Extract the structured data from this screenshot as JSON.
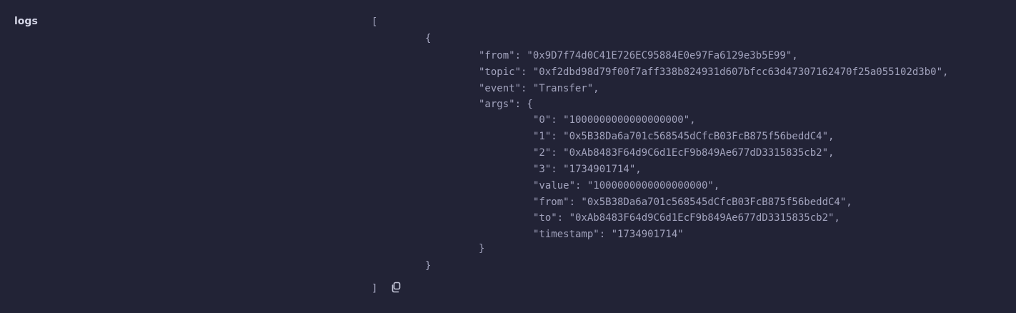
{
  "field": {
    "label": "logs"
  },
  "json_lines": {
    "open_bracket": "[",
    "open_brace": "{",
    "from": "\"from\": \"0x9D7f74d0C41E726EC95884E0e97Fa6129e3b5E99\",",
    "topic": "\"topic\": \"0xf2dbd98d79f00f7aff338b824931d607bfcc63d47307162470f25a055102d3b0\",",
    "event": "\"event\": \"Transfer\",",
    "args_open": "\"args\": {",
    "arg_0": "\"0\": \"1000000000000000000\",",
    "arg_1": "\"1\": \"0x5B38Da6a701c568545dCfcB03FcB875f56beddC4\",",
    "arg_2": "\"2\": \"0xAb8483F64d9C6d1EcF9b849Ae677dD3315835cb2\",",
    "arg_3": "\"3\": \"1734901714\",",
    "arg_value": "\"value\": \"1000000000000000000\",",
    "arg_from": "\"from\": \"0x5B38Da6a701c568545dCfcB03FcB875f56beddC4\",",
    "arg_to": "\"to\": \"0xAb8483F64d9C6d1EcF9b849Ae677dD3315835cb2\",",
    "arg_timestamp": "\"timestamp\": \"1734901714\"",
    "args_close": "}",
    "close_brace": "}",
    "close_bracket": "]"
  },
  "icons": {
    "copy": "copy-icon"
  }
}
